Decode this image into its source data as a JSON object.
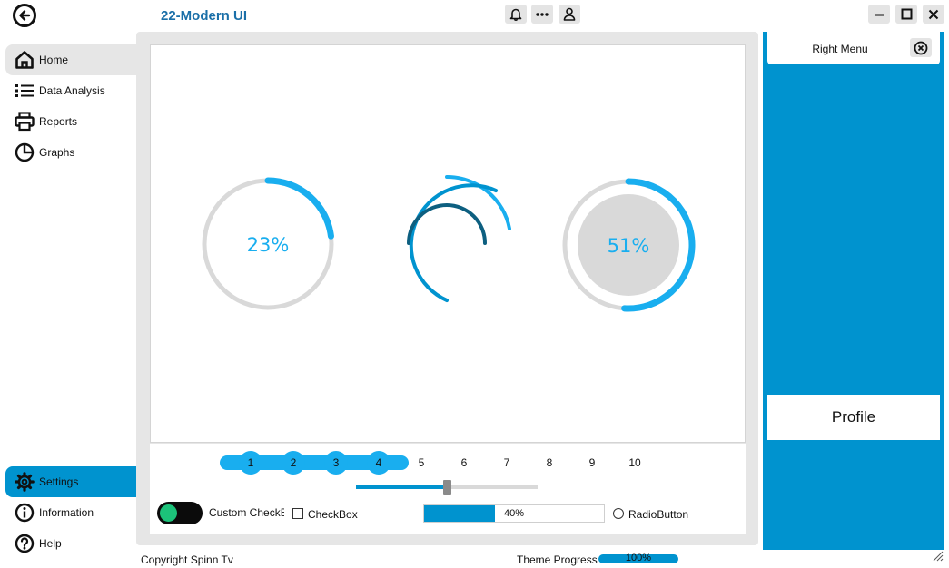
{
  "header": {
    "title": "22-Modern UI"
  },
  "sidebar": {
    "items": [
      {
        "label": "Home"
      },
      {
        "label": "Data Analysis"
      },
      {
        "label": "Reports"
      },
      {
        "label": "Graphs"
      }
    ],
    "bottom_items": [
      {
        "label": "Settings"
      },
      {
        "label": "Information"
      },
      {
        "label": "Help"
      }
    ]
  },
  "gauges": [
    {
      "value": 0.23,
      "text": "23%"
    },
    {
      "value": null,
      "text": ""
    },
    {
      "value": 0.51,
      "text": "51%"
    }
  ],
  "stepper": {
    "steps": [
      "1",
      "2",
      "3",
      "4",
      "5",
      "6",
      "7",
      "8",
      "9",
      "10"
    ],
    "completed": 4
  },
  "slider": {
    "value": 0.5
  },
  "controls": {
    "toggle_on": true,
    "custom_check_label": "Custom CheckBox",
    "checkbox_label": "CheckBox",
    "checkbox_checked": false,
    "progress_value": 0.4,
    "progress_text": "40%",
    "radio_label": "RadioButton",
    "radio_checked": false
  },
  "footer": {
    "copyright": "Copyright Spinn Tv",
    "theme_label": "Theme Progress",
    "theme_progress_text": "100%",
    "theme_progress_value": 1.0
  },
  "right_menu": {
    "title": "Right Menu",
    "profile_label": "Profile"
  },
  "colors": {
    "accent": "#0093cf",
    "gauge_blue": "#19aeef",
    "gauge_dark": "#0d5f80",
    "track_gray": "#d9d9d9",
    "toggle_green": "#1cc27a"
  }
}
